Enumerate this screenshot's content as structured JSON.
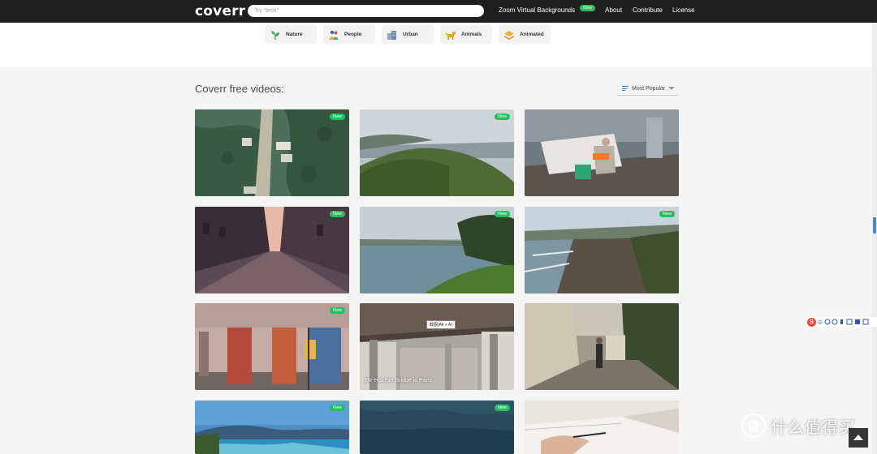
{
  "header": {
    "logo": "coverr",
    "search_placeholder": "Try \"tech\"",
    "links": {
      "zoom": "Zoom Virtual Backgrounds",
      "zoom_badge": "New",
      "about": "About",
      "contribute": "Contribute",
      "license": "License"
    }
  },
  "categories": [
    {
      "label": "Nature",
      "icon": "leaf-icon"
    },
    {
      "label": "People",
      "icon": "people-icon"
    },
    {
      "label": "Urban",
      "icon": "building-icon"
    },
    {
      "label": "Animals",
      "icon": "dog-icon"
    },
    {
      "label": "Animated",
      "icon": "layers-icon"
    }
  ],
  "main": {
    "heading": "Coverr free videos:",
    "sort": "Most Popular"
  },
  "videos": [
    {
      "badge": "New",
      "scene": "flooded-street-aerial"
    },
    {
      "badge": "New",
      "scene": "coastal-hills"
    },
    {
      "badge": "",
      "scene": "man-on-dock"
    },
    {
      "badge": "New",
      "scene": "empty-city-street"
    },
    {
      "badge": "New",
      "scene": "lake-shore"
    },
    {
      "badge": "New",
      "scene": "beach-waves"
    },
    {
      "badge": "New",
      "scene": "street-graffiti"
    },
    {
      "badge": "",
      "scene": "bridge-underside",
      "caption": "Bir-Hakeim Bridge in Paris",
      "tooltip": "截图(Alt + A)"
    },
    {
      "badge": "",
      "scene": "man-walking-boulevard"
    },
    {
      "badge": "New",
      "scene": "bay-mountains"
    },
    {
      "badge": "New",
      "scene": "ocean-water"
    },
    {
      "badge": "",
      "scene": "writing-notebook"
    }
  ],
  "ime_toolbar": {
    "logo": "S",
    "lang": "中"
  },
  "watermark": {
    "mark": "值",
    "text": "什么值得买"
  }
}
